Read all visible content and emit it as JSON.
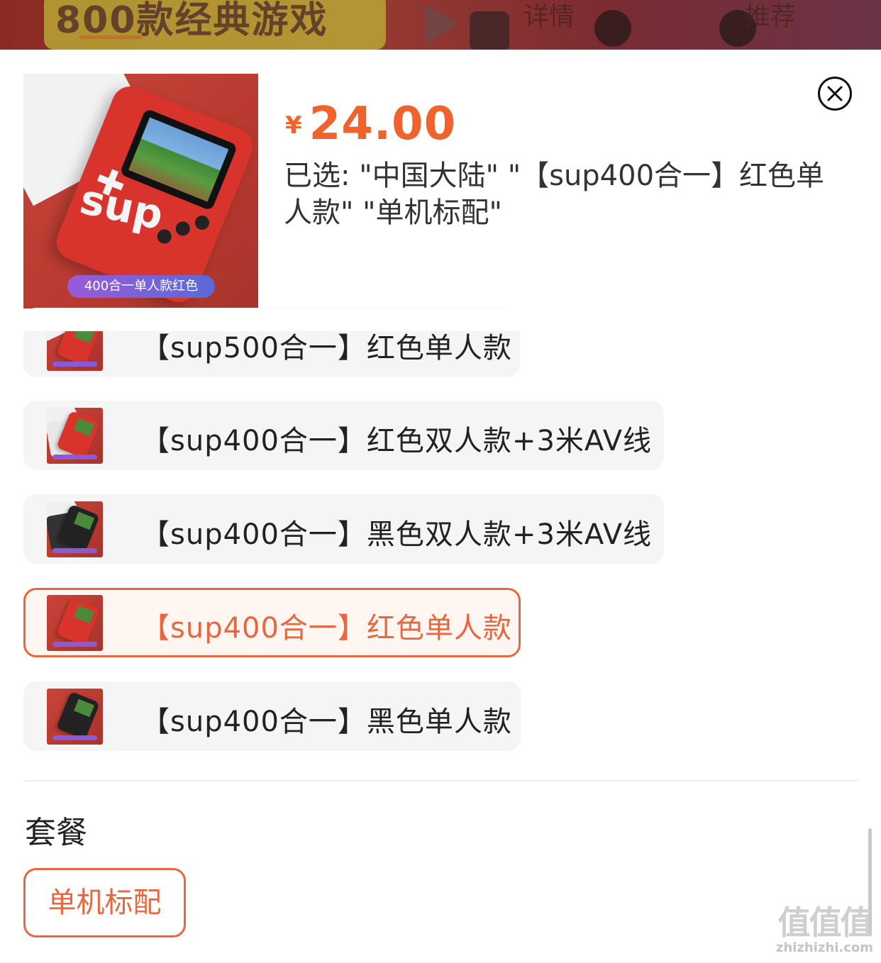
{
  "background_page": {
    "banner_text": "800款经典游戏",
    "tabs": [
      "详情",
      "推荐"
    ]
  },
  "product": {
    "image_caption": "400合一单人款红色",
    "console_logo": "sup",
    "price_currency": "¥",
    "price_amount": "24.00",
    "selected_summary": "已选: \"中国大陆\" \"【sup400合一】红色单人款\" \"单机标配\""
  },
  "variants": [
    {
      "label": "【sup500合一】红色单人款",
      "selected": false
    },
    {
      "label": "【sup400合一】红色双人款+3米AV线",
      "selected": false
    },
    {
      "label": "【sup400合一】黑色双人款+3米AV线",
      "selected": false
    },
    {
      "label": "【sup400合一】红色单人款",
      "selected": true
    },
    {
      "label": "【sup400合一】黑色单人款",
      "selected": false
    }
  ],
  "package_section": {
    "title": "套餐",
    "options": [
      {
        "label": "单机标配",
        "selected": true
      }
    ]
  },
  "icons": {
    "close": "close-icon"
  },
  "colors": {
    "accent": "#e8673e",
    "price": "#f0632c"
  },
  "watermark": {
    "big": "值值值",
    "small": "zhizhizhi.com"
  }
}
